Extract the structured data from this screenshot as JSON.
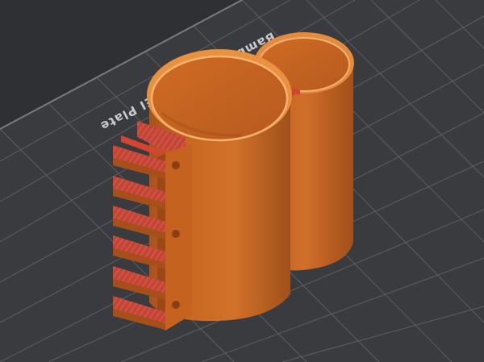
{
  "viewer": {
    "bed": {
      "label": "Bambu Textured PEI Plate",
      "plate_color": "#3a3b3f",
      "grid_color": "#6c6d72",
      "background_color": "#2f3033"
    },
    "model": {
      "description_colors": {
        "body": "#c86522",
        "body_shadow": "#9a4a17",
        "rim": "#f1a35a",
        "infill_accent": "#d23a2c"
      }
    }
  }
}
